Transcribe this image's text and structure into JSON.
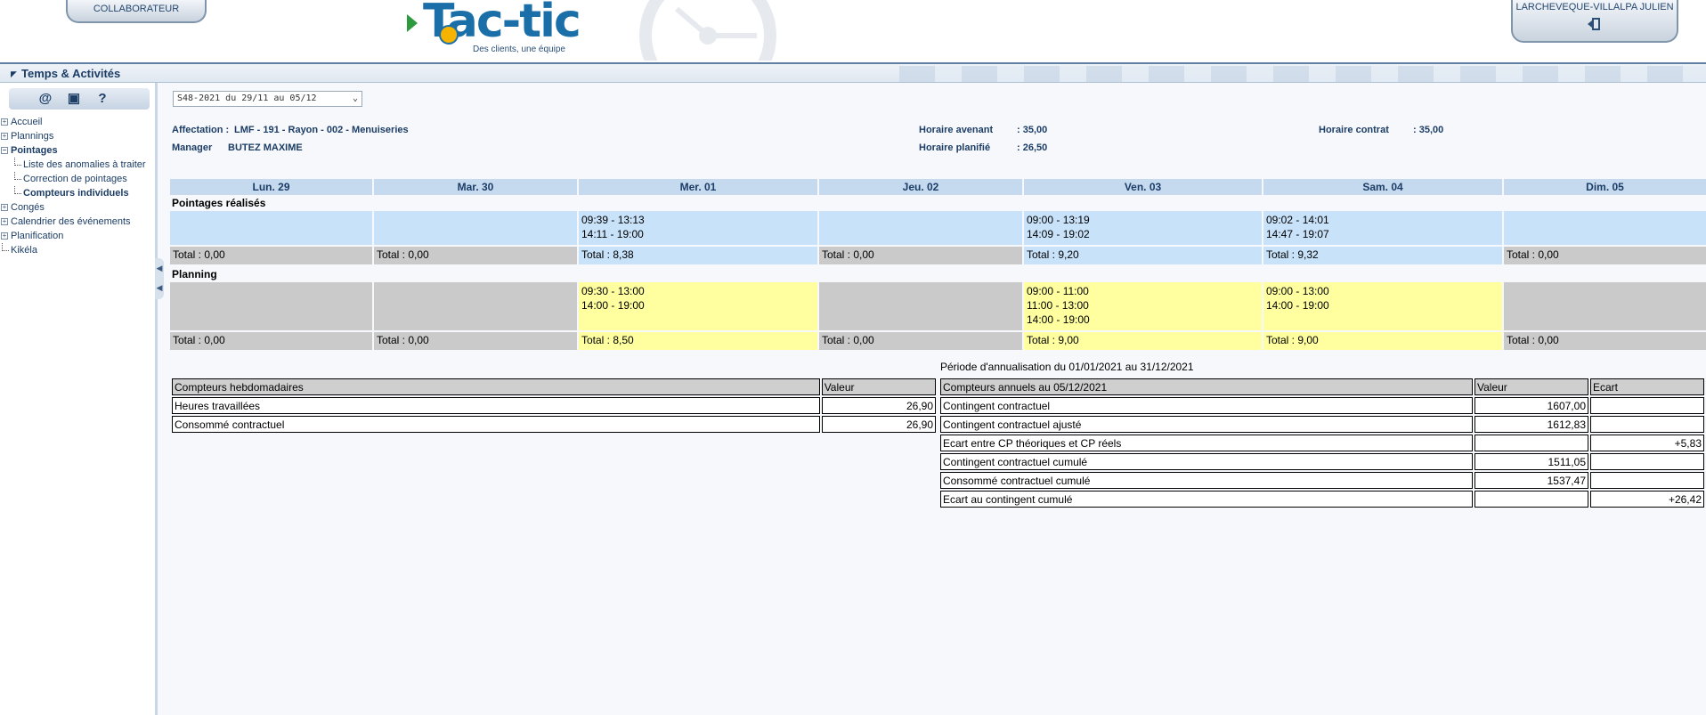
{
  "header": {
    "collab_tab": "COLLABORATEUR",
    "user_name": "LARCHEVEQUE-VILLALPA JULIEN",
    "logo_text": "Tac-tic",
    "logo_tagline": "Des clients, une équipe",
    "logout_icon": "logout-door-icon"
  },
  "titlebar": {
    "title": "Temps & Activités"
  },
  "sidebar": {
    "toolbar": [
      "at-icon",
      "clapper-icon",
      "help-icon"
    ],
    "items": {
      "accueil": "Accueil",
      "plannings": "Plannings",
      "pointages": "Pointages",
      "anomalies": "Liste des anomalies à traiter",
      "correction": "Correction de pointages",
      "compteurs": "Compteurs individuels",
      "conges": "Congés",
      "calendrier": "Calendrier des événements",
      "planification": "Planification",
      "kikela": "Kikéla"
    }
  },
  "main": {
    "week_select": "S48-2021 du 29/11 au 05/12",
    "affectation_label": "Affectation :",
    "affectation_value": "LMF - 191 - Rayon - 002 - Menuiseries",
    "manager_label": "Manager",
    "manager_value": "BUTEZ MAXIME",
    "horaire_avenant_label": "Horaire avenant",
    "horaire_avenant_value": ": 35,00",
    "horaire_planifie_label": "Horaire planifié",
    "horaire_planifie_value": ": 26,50",
    "horaire_contrat_label": "Horaire contrat",
    "horaire_contrat_value": ": 35,00"
  },
  "week": {
    "days": [
      "Lun. 29",
      "Mar. 30",
      "Mer. 01",
      "Jeu. 02",
      "Ven. 03",
      "Sam. 04",
      "Dim. 05"
    ],
    "pointages_title": "Pointages réalisés",
    "pointages": [
      [
        "",
        ""
      ],
      [
        "",
        ""
      ],
      [
        "09:39 - 13:13",
        "14:11 - 19:00"
      ],
      [
        "",
        ""
      ],
      [
        "09:00 - 13:19",
        "14:09 - 19:02"
      ],
      [
        "09:02 - 14:01",
        "14:47 - 19:07"
      ],
      [
        "",
        ""
      ]
    ],
    "pointages_totals": [
      "Total : 0,00",
      "Total : 0,00",
      "Total : 8,38",
      "Total : 0,00",
      "Total : 9,20",
      "Total : 9,32",
      "Total : 0,00"
    ],
    "planning_title": "Planning",
    "planning": [
      [
        "",
        "",
        ""
      ],
      [
        "",
        "",
        ""
      ],
      [
        "09:30 - 13:00",
        "14:00 - 19:00",
        ""
      ],
      [
        "",
        "",
        ""
      ],
      [
        "09:00 - 11:00",
        "11:00 - 13:00",
        "14:00 - 19:00"
      ],
      [
        "09:00 - 13:00",
        "14:00 - 19:00",
        ""
      ],
      [
        "",
        "",
        ""
      ]
    ],
    "planning_totals": [
      "Total : 0,00",
      "Total : 0,00",
      "Total : 8,50",
      "Total : 0,00",
      "Total : 9,00",
      "Total : 9,00",
      "Total : 0,00"
    ]
  },
  "weekly_counters": {
    "headers": [
      "Compteurs hebdomadaires",
      "Valeur"
    ],
    "rows": [
      [
        "Heures travaillées",
        "26,90"
      ],
      [
        "Consommé contractuel",
        "26,90"
      ]
    ]
  },
  "annual_counters": {
    "period": "Période d'annualisation du 01/01/2021 au 31/12/2021",
    "headers": [
      "Compteurs annuels au 05/12/2021",
      "Valeur",
      "Ecart"
    ],
    "rows": [
      [
        "Contingent contractuel",
        "1607,00",
        ""
      ],
      [
        "Contingent contractuel ajusté",
        "1612,83",
        ""
      ],
      [
        "Ecart entre CP théoriques et CP réels",
        "",
        "+5,83"
      ],
      [
        "Contingent contractuel cumulé",
        "1511,05",
        ""
      ],
      [
        "Consommé contractuel cumulé",
        "1537,47",
        ""
      ],
      [
        "Ecart au contingent cumulé",
        "",
        "+26,42"
      ]
    ]
  },
  "colors": {
    "header_blue": "#c5d9ef",
    "pointage_blue": "#c8e2f9",
    "planning_yellow": "#ffffa0",
    "empty_gray": "#cacaca",
    "text_navy": "#1c3d66"
  }
}
